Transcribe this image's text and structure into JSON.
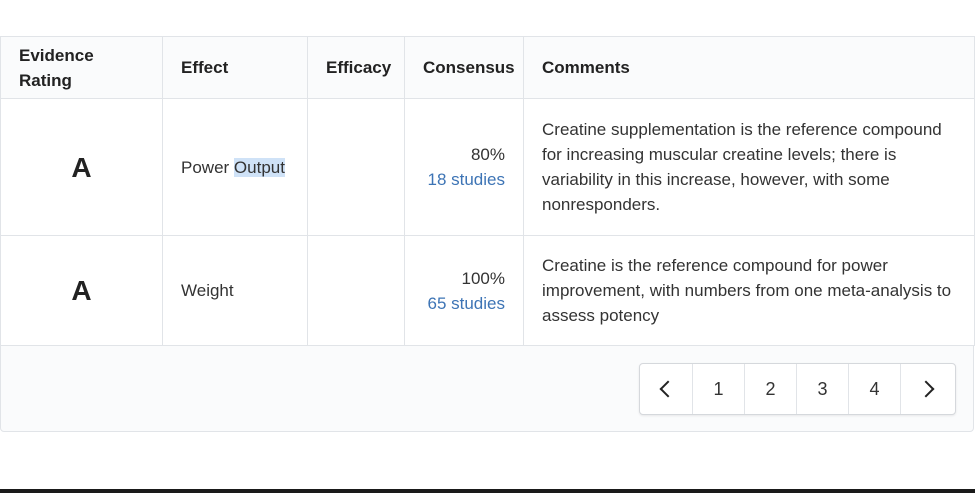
{
  "table": {
    "headers": {
      "rating": "Evidence Rating",
      "effect": "Effect",
      "efficacy": "Efficacy",
      "consensus": "Consensus",
      "comments": "Comments"
    },
    "rows": [
      {
        "rating": "A",
        "effect_a": "Power ",
        "effect_b": "Output",
        "efficacy": "",
        "consensus_pct": "80%",
        "studies": "18 studies",
        "comment": "Creatine supplementation is the reference compound for increasing muscular creatine levels; there is variability in this increase, however, with some nonresponders."
      },
      {
        "rating": "A",
        "effect_a": "Weight",
        "effect_b": "",
        "efficacy": "",
        "consensus_pct": "100%",
        "studies": "65 studies",
        "comment": "Creatine is the reference compound for power improvement, with numbers from one meta-analysis to assess potency"
      }
    ]
  },
  "pagination": {
    "pages": [
      "1",
      "2",
      "3",
      "4"
    ],
    "prev_icon": "chevron-left-icon",
    "next_icon": "chevron-right-icon"
  },
  "colors": {
    "link": "#3d74b5",
    "highlight": "#cfe2f7",
    "border": "#e1e4e8"
  }
}
